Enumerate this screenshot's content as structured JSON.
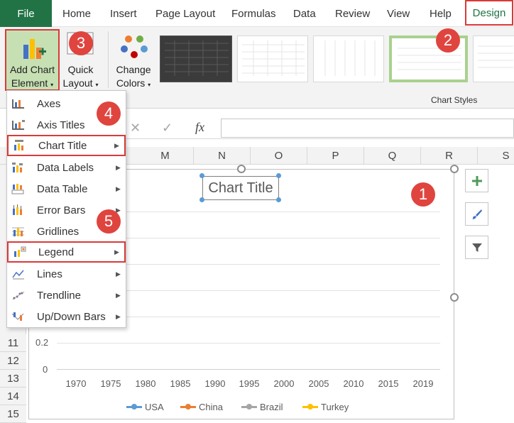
{
  "tabs": [
    "File",
    "Home",
    "Insert",
    "Page Layout",
    "Formulas",
    "Data",
    "Review",
    "View",
    "Help",
    "Design"
  ],
  "ribbon": {
    "add_chart_element": "Add Chart Element",
    "add_chart_line1": "Add Chart",
    "add_chart_line2": "Element",
    "quick_layout_line1": "Quick",
    "quick_layout_line2": "Layout",
    "change_colors_line1": "Change",
    "change_colors_line2": "Colors",
    "chart_styles_label": "Chart Styles"
  },
  "menu": {
    "items": [
      {
        "label": "Axes",
        "has_submenu": false
      },
      {
        "label": "Axis Titles",
        "has_submenu": false
      },
      {
        "label": "Chart Title",
        "has_submenu": true
      },
      {
        "label": "Data Labels",
        "has_submenu": true
      },
      {
        "label": "Data Table",
        "has_submenu": true
      },
      {
        "label": "Error Bars",
        "has_submenu": true
      },
      {
        "label": "Gridlines",
        "has_submenu": false
      },
      {
        "label": "Legend",
        "has_submenu": true
      },
      {
        "label": "Lines",
        "has_submenu": true
      },
      {
        "label": "Trendline",
        "has_submenu": true
      },
      {
        "label": "Up/Down Bars",
        "has_submenu": true
      }
    ]
  },
  "columns": [
    "M",
    "N",
    "O",
    "P",
    "Q",
    "R",
    "S"
  ],
  "rows": [
    "11",
    "12",
    "13",
    "14",
    "15"
  ],
  "chart": {
    "title": "Chart Title",
    "y_ticks": [
      "0.2",
      "0"
    ],
    "x_ticks": [
      "1970",
      "1975",
      "1980",
      "1985",
      "1990",
      "1995",
      "2000",
      "2005",
      "2010",
      "2015",
      "2019"
    ],
    "legend": [
      {
        "name": "USA",
        "color": "#5b9bd5"
      },
      {
        "name": "China",
        "color": "#ed7d31"
      },
      {
        "name": "Brazil",
        "color": "#a5a5a5"
      },
      {
        "name": "Turkey",
        "color": "#ffc000"
      }
    ]
  },
  "badges": [
    "1",
    "2",
    "3",
    "4",
    "5"
  ],
  "colors": {
    "accent_green": "#217346",
    "highlight_red": "#d93a3a",
    "badge_red": "#e0443e"
  }
}
